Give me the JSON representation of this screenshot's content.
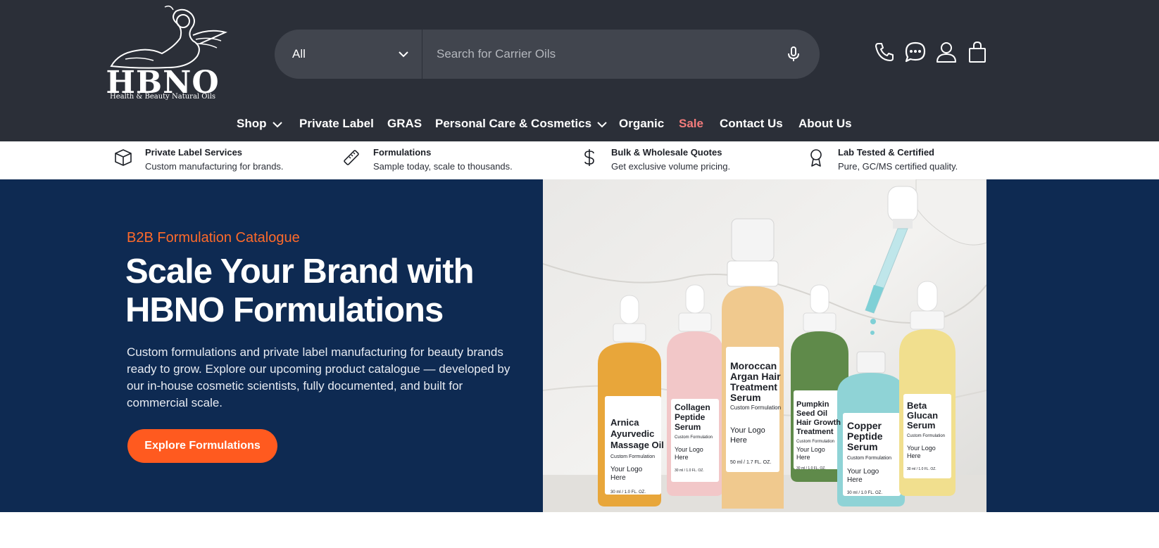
{
  "logo": {
    "main": "HBNO",
    "sub": "Health & Beauty Natural Oils"
  },
  "search": {
    "category": "All",
    "placeholder": "Search for Carrier Oils"
  },
  "header_icons": [
    "phone-icon",
    "chat-icon",
    "account-icon",
    "cart-icon"
  ],
  "nav": {
    "shop": "Shop",
    "private_label": "Private Label",
    "gras": "GRAS",
    "personal_care": "Personal Care & Cosmetics",
    "organic": "Organic",
    "sale": "Sale",
    "contact": "Contact Us",
    "about": "About Us"
  },
  "features": [
    {
      "icon": "box-icon",
      "title": "Private Label Services",
      "desc": "Custom manufacturing for brands."
    },
    {
      "icon": "ruler-icon",
      "title": "Formulations",
      "desc": "Sample today, scale to thousands."
    },
    {
      "icon": "dollar-icon",
      "title": "Bulk & Wholesale Quotes",
      "desc": "Get exclusive volume pricing."
    },
    {
      "icon": "award-icon",
      "title": "Lab Tested & Certified",
      "desc": "Pure, GC/MS certified quality."
    }
  ],
  "hero": {
    "eyebrow": "B2B Formulation Catalogue",
    "headline_line1": "Scale Your Brand with",
    "headline_line2": "HBNO Formulations",
    "body": "Custom formulations and private label manufacturing for beauty brands ready to grow. Explore our upcoming product catalogue — developed by our in-house cosmetic scientists, fully documented, and built for commercial scale.",
    "cta": "Explore Formulations"
  },
  "product_labels": {
    "arnica": [
      "Arnica",
      "Ayurvedic",
      "Massage Oil"
    ],
    "collagen": [
      "Collagen",
      "Peptide",
      "Serum"
    ],
    "moroccan": [
      "Moroccan",
      "Argan Hair",
      "Treatment",
      "Serum"
    ],
    "pumpkin": [
      "Pumpkin",
      "Seed Oil",
      "Hair Growth",
      "Treatment"
    ],
    "copper": [
      "Copper",
      "Peptide",
      "Serum"
    ],
    "beta": [
      "Beta",
      "Glucan",
      "Serum"
    ],
    "custom": "Custom Formulation",
    "logo_line1": "Your Logo",
    "logo_line2": "Here",
    "vol_30": "30 ml / 1.0 FL. OZ.",
    "vol_50": "50 ml / 1.7 FL. OZ."
  },
  "colors": {
    "header_bg": "#2b2f38",
    "hero_bg": "#0e2a52",
    "accent": "#ff5a1f",
    "sale": "#f47c7c"
  }
}
